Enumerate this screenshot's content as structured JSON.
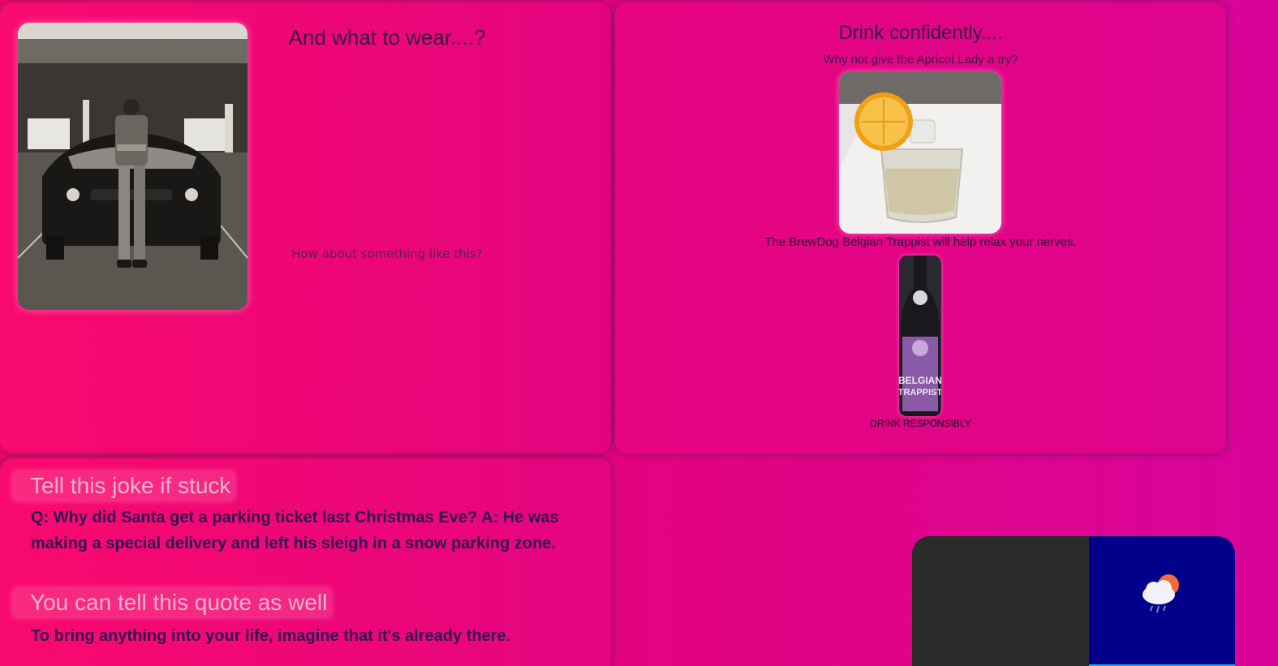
{
  "wear_card": {
    "title": "And what to wear....?",
    "subtitle": "How about something like this?"
  },
  "drink_card": {
    "title": "Drink confidently....",
    "subtitle": "Why not give the Apricot Lady a try?",
    "beer_text": "The BrewDog Belgian Trappist will help relax your nerves.",
    "footer": "DRINK RESPONSIBLY",
    "bottle_label_line1": "BELGIAN",
    "bottle_label_line2": "TRAPPIST"
  },
  "joke_card": {
    "joke_heading": "Tell this joke if stuck",
    "joke_text": "Q: Why did Santa get a parking ticket last Christmas Eve? A: He was making a special delivery and left his sleigh in a snow parking zone.",
    "quote_heading": "You can tell this quote as well",
    "quote_text": "To bring anything into your life, imagine that it's already there."
  },
  "weather": {
    "icon": "cloud-sun-rain-icon",
    "colors": {
      "left_panel": "#2b2b2b",
      "right_panel": "#00008a",
      "bar": "#2aa7e0"
    }
  },
  "theme": {
    "background_start": "#f4076e",
    "background_end": "#d8049a",
    "text_dark": "#3a1244"
  }
}
